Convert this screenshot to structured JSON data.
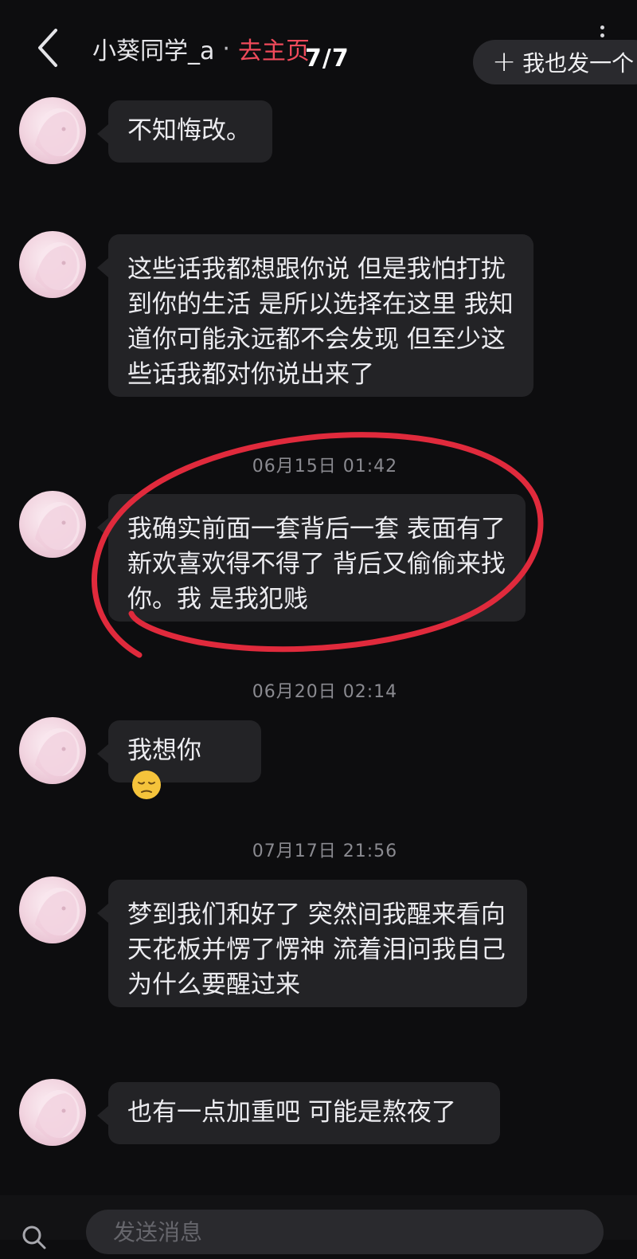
{
  "header": {
    "title": "小葵同学_a",
    "separator": "·",
    "home_link": "去主页",
    "page_indicator": "7/7",
    "post_button_icon": "plus-icon",
    "post_button_label": "我也发一个"
  },
  "messages": [
    {
      "text": "不知悔改。"
    },
    {
      "text": "这些话我都想跟你说 但是我怕打扰到你的生活 是所以选择在这里 我知道你可能永远都不会发现 但至少这些话我都对你说出来了"
    },
    {
      "timestamp": "06月15日 01:42",
      "text": "我确实前面一套背后一套 表面有了新欢喜欢得不得了 背后又偷偷来找你。我 是我犯贱",
      "highlighted": true
    },
    {
      "timestamp": "06月20日 02:14",
      "text": "我想你",
      "emoji": "pensive-face"
    },
    {
      "timestamp": "07月17日 21:56",
      "text": "梦到我们和好了 突然间我醒来看向天花板并愣了愣神 流着泪问我自己为什么要醒过来"
    },
    {
      "text": "也有一点加重吧 可能是熬夜了"
    }
  ],
  "input": {
    "placeholder": "发送消息"
  },
  "colors": {
    "background": "#0d0d0f",
    "bubble": "#232326",
    "accent_link": "#f04a5b",
    "annotation_circle": "#e02a3c"
  }
}
